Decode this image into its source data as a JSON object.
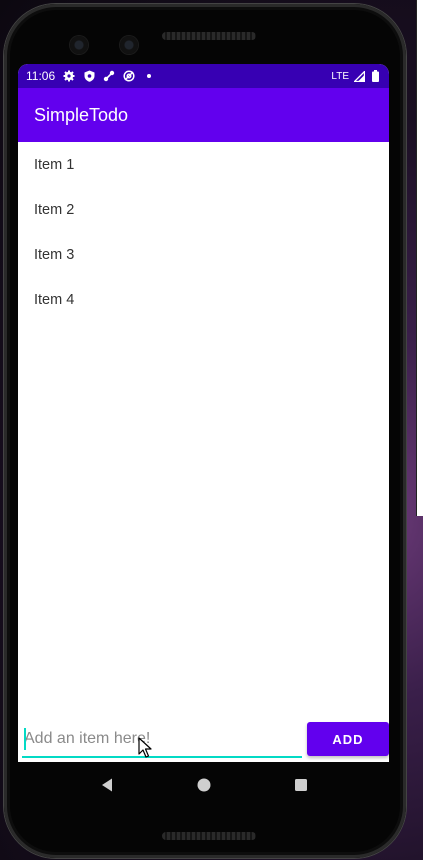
{
  "status_bar": {
    "time": "11:06",
    "network": "LTE",
    "icons": [
      "settings-icon",
      "shield-icon",
      "key-icon",
      "at-sign-icon",
      "dot-icon",
      "signal-icon",
      "battery-icon"
    ]
  },
  "app_bar": {
    "title": "SimpleTodo"
  },
  "todo_list": {
    "items": [
      {
        "label": "Item 1"
      },
      {
        "label": "Item 2"
      },
      {
        "label": "Item 3"
      },
      {
        "label": "Item 4"
      }
    ]
  },
  "input": {
    "placeholder": "Add an item here!",
    "value": ""
  },
  "add_button": {
    "label": "ADD"
  },
  "nav_bar": {
    "buttons": [
      "back-icon",
      "home-icon",
      "recents-icon"
    ]
  },
  "colors": {
    "status_bar": "#3700b3",
    "primary": "#6200ee",
    "accent": "#03dac5"
  }
}
